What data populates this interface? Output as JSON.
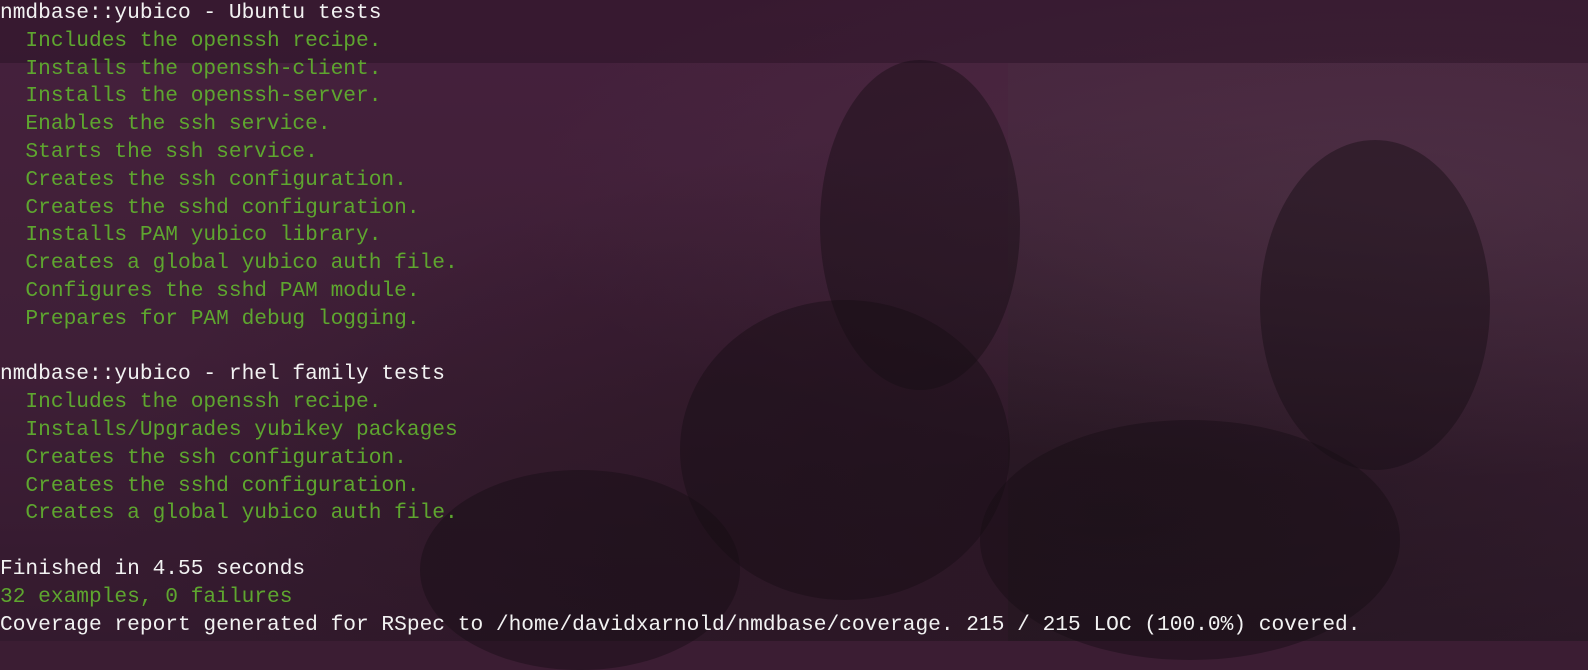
{
  "colors": {
    "header_text": "#f2f2f2",
    "pass_text": "#5ea62f",
    "background": "#3b1d33"
  },
  "terminal": {
    "ubuntu_heading": "nmdbase::yubico - Ubuntu tests",
    "ubuntu_tests": [
      "  Includes the openssh recipe.",
      "  Installs the openssh-client.",
      "  Installs the openssh-server.",
      "  Enables the ssh service.",
      "  Starts the ssh service.",
      "  Creates the ssh configuration.",
      "  Creates the sshd configuration.",
      "  Installs PAM yubico library.",
      "  Creates a global yubico auth file.",
      "  Configures the sshd PAM module.",
      "  Prepares for PAM debug logging."
    ],
    "rhel_heading": "nmdbase::yubico - rhel family tests",
    "rhel_tests": [
      "  Includes the openssh recipe.",
      "  Installs/Upgrades yubikey packages",
      "  Creates the ssh configuration.",
      "  Creates the sshd configuration.",
      "  Creates a global yubico auth file."
    ],
    "finished": "Finished in 4.55 seconds",
    "summary": "32 examples, 0 failures",
    "coverage": "Coverage report generated for RSpec to /home/davidxarnold/nmdbase/coverage. 215 / 215 LOC (100.0%) covered."
  }
}
